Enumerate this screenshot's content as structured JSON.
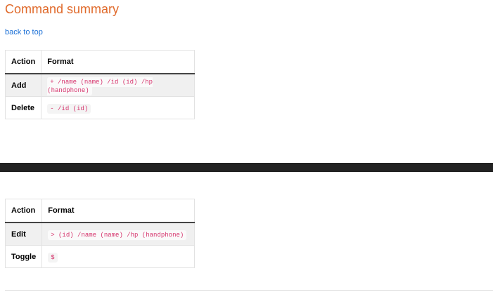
{
  "title": "Command summary",
  "back_link": "back to top",
  "headers": {
    "action": "Action",
    "format": "Format"
  },
  "table1": [
    {
      "action": "Add",
      "format": "+ /name (name) /id (id) /hp (handphone)"
    },
    {
      "action": "Delete",
      "format": "- /id (id)"
    }
  ],
  "table2": [
    {
      "action": "Edit",
      "format": "> (id) /name (name) /hp (handphone)"
    },
    {
      "action": "Toggle",
      "format": "$"
    }
  ]
}
